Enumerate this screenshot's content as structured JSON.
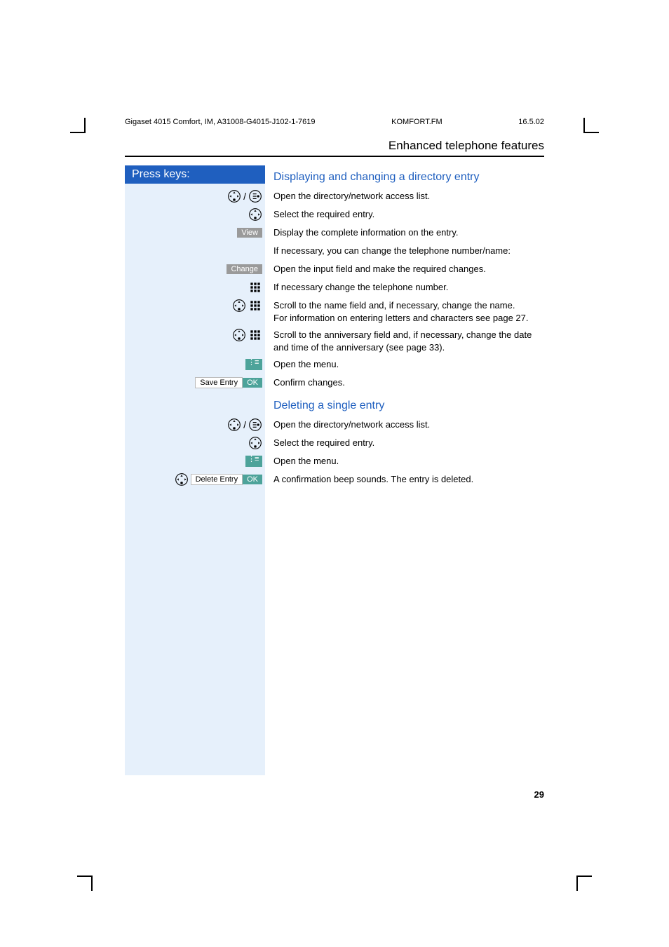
{
  "header": {
    "left": "Gigaset 4015 Comfort, IM, A31008-G4015-J102-1-7619",
    "mid": "KOMFORT.FM",
    "right": "16.5.02"
  },
  "section_title": "Enhanced telephone features",
  "keycol_header": "Press keys:",
  "h_display": "Displaying and changing a directory entry",
  "h_delete": "Deleting a single entry",
  "softkey_view": "View",
  "softkey_change": "Change",
  "softkey_ok": "OK",
  "menu_save": "Save Entry",
  "menu_delete": "Delete Entry",
  "steps": {
    "open_dir": "Open the directory/network access list.",
    "select_entry": "Select the required entry.",
    "display_info": "Display the complete information on the entry.",
    "if_necessary": "If necessary, you can change the telephone number/name:",
    "open_input": "Open the input field and make the required changes.",
    "change_tel": "If necessary change the telephone number.",
    "scroll_name": "Scroll to the name field and, if necessary, change the name.\nFor information on entering letters and characters see page 27.",
    "scroll_anniv": "Scroll to the anniversary field and, if necessary, change the date and time of the anniversary (see page 33).",
    "open_menu": "Open the menu.",
    "confirm": "Confirm changes.",
    "deleted": "A confirmation beep sounds. The entry is deleted."
  },
  "page_number": "29"
}
